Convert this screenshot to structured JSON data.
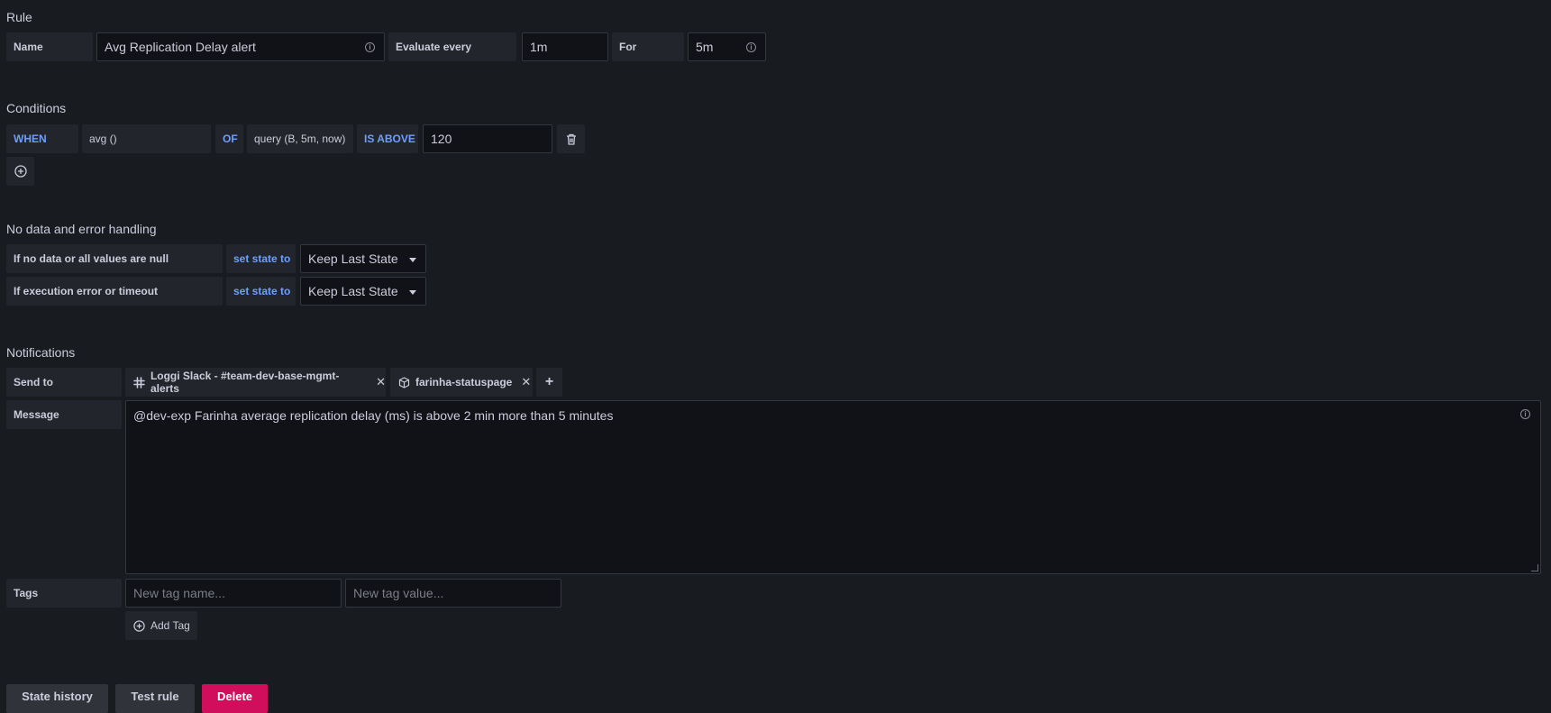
{
  "rule": {
    "section_title": "Rule",
    "name_label": "Name",
    "name_value": "Avg Replication Delay alert",
    "evaluate_label": "Evaluate every",
    "evaluate_value": "1m",
    "for_label": "For",
    "for_value": "5m"
  },
  "conditions": {
    "section_title": "Conditions",
    "when_label": "WHEN",
    "reducer": "avg ()",
    "of_label": "OF",
    "query": "query (B, 5m, now)",
    "evaluator_label": "IS ABOVE",
    "threshold": "120"
  },
  "no_data": {
    "section_title": "No data and error handling",
    "rows": [
      {
        "label": "If no data or all values are null",
        "set_label": "set state to",
        "value": "Keep Last State"
      },
      {
        "label": "If execution error or timeout",
        "set_label": "set state to",
        "value": "Keep Last State"
      }
    ]
  },
  "notifications": {
    "section_title": "Notifications",
    "send_to_label": "Send to",
    "channels": [
      {
        "icon": "slack-icon",
        "name": "Loggi Slack - #team-dev-base-mgmt-alerts"
      },
      {
        "icon": "cube-icon",
        "name": "farinha-statuspage"
      }
    ],
    "message_label": "Message",
    "message_value": "@dev-exp Farinha average replication delay (ms) is above 2 min more than 5 minutes",
    "tags_label": "Tags",
    "tag_name_placeholder": "New tag name...",
    "tag_value_placeholder": "New tag value...",
    "add_tag_label": "Add Tag"
  },
  "footer": {
    "state_history_label": "State history",
    "test_rule_label": "Test rule",
    "delete_label": "Delete"
  },
  "colors": {
    "background": "#181b1f",
    "keyword": "#6e9fff",
    "danger": "#d10e5c"
  }
}
